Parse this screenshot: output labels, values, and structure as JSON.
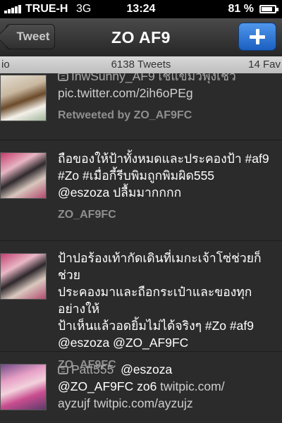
{
  "status_bar": {
    "carrier": "TRUE-H",
    "network": "3G",
    "time": "13:24",
    "battery": "81 %",
    "battery_level": 0.81
  },
  "nav": {
    "back_label": "Tweet",
    "title": "ZO AF9",
    "compose_icon": "plus-icon"
  },
  "stats": {
    "left_fragment": "io",
    "tweets": "6138 Tweets",
    "right_fragment": "14 Fav"
  },
  "tweets": [
    {
      "retweet_icon": "retweet-icon",
      "line1": "InwSunny_AF9 เชแขมวพุงเชว",
      "line2": "pic.twitter.com/2ih6oPEg",
      "meta": "Retweeted by ZO_AF9FC"
    },
    {
      "line1": "ถือของให้ป้าทั้งหมดและประคองป้า #af9",
      "line2": "#Zo #เมื่อกี้รีบพิมถูกพิมผิด555",
      "line3": "@eszoza ปลื้มมากกกก",
      "meta": "ZO_AF9FC"
    },
    {
      "line1": "ป้าปอร้องเท้ากัดเดินที่เมกะเจ้าโซ่ช่วยก็ช่วย",
      "line2": "ประคองมาและถือกระเป๋าและของทุกอย่างให้",
      "line3": "ป้าเห็นแล้วอดยิ้มไม่ได้จริงๆ #Zo #af9",
      "line4": "@eszoza @ZO_AF9FC",
      "meta": "ZO_AF9FC"
    },
    {
      "retweet_icon": "retweet-icon",
      "user": "Patt555",
      "line1_rest": "@eszoza",
      "line2_text": "@ZO_AF9FC  zo6 ",
      "line2_link": "twitpic.com/",
      "line3": "ayzujf twitpic.com/ayzujz"
    }
  ],
  "colors": {
    "background": "#2b2b2b",
    "compose_blue": "#2f7de0",
    "strip": "#cccccc",
    "meta_gray": "#8f8f8f"
  }
}
